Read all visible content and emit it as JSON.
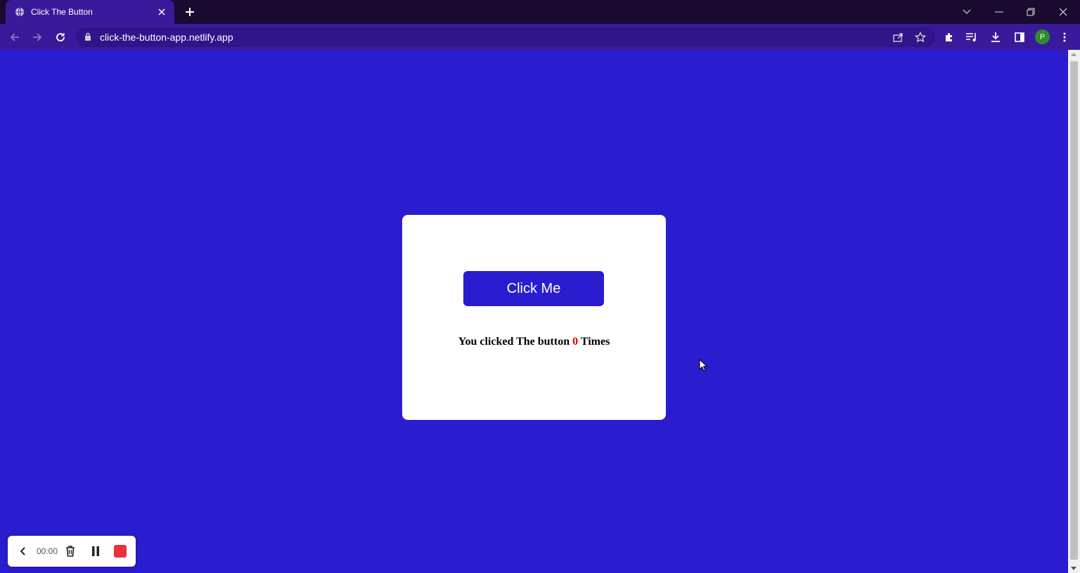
{
  "browser": {
    "tab_title": "Click The Button",
    "url": "click-the-button-app.netlify.app",
    "profile_initial": "P"
  },
  "app": {
    "button_label": "Click Me",
    "counter_prefix": "You clicked The button",
    "counter_value": "0",
    "counter_suffix": "Times"
  },
  "recorder": {
    "time": "00:00"
  },
  "colors": {
    "page_background": "#2a1ccf",
    "button_background": "#2a1ccf",
    "counter_value": "#e00000",
    "record_stop": "#e8323c"
  }
}
